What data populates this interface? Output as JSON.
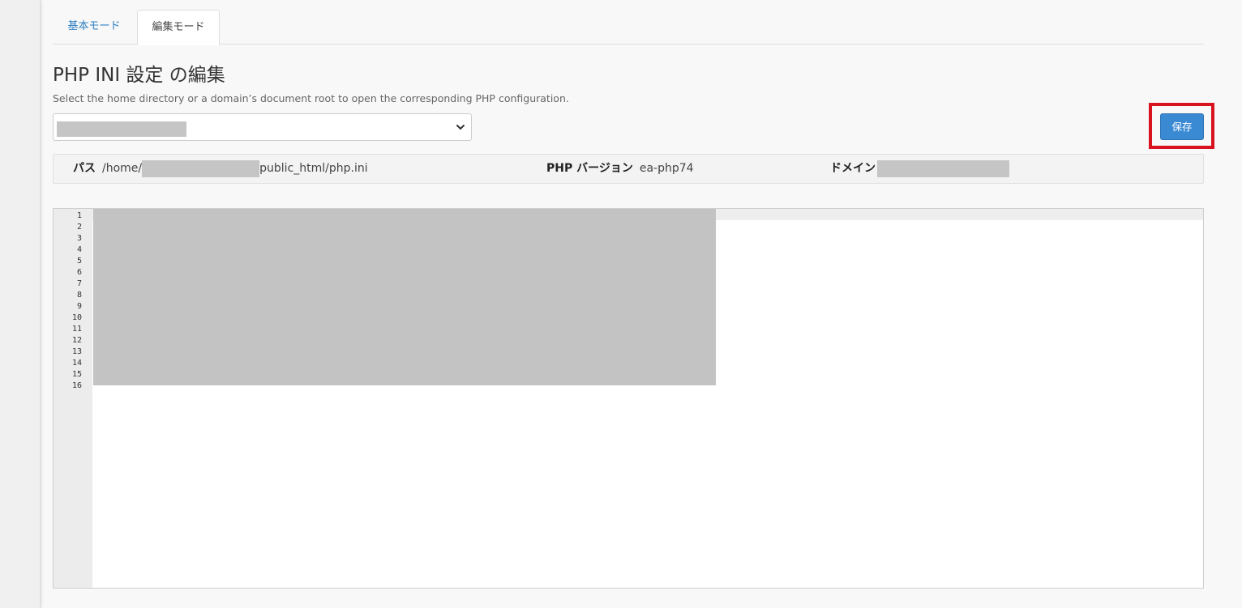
{
  "tabs": [
    {
      "label": "基本モード",
      "active": false
    },
    {
      "label": "編集モード",
      "active": true
    }
  ],
  "page": {
    "title": "PHP INI 設定 の編集",
    "subtitle": "Select the home directory or a domain’s document root to open the corresponding PHP configuration."
  },
  "directory_select": {
    "value_redacted": true
  },
  "toolbar": {
    "save_label": "保存"
  },
  "info": {
    "path_label": "パス",
    "path_prefix": "/home/",
    "path_suffix": "public_html/php.ini",
    "php_version_label": "PHP バージョン",
    "php_version_value": "ea-php74",
    "domain_label": "ドメイン"
  },
  "editor": {
    "line_numbers": [
      "1",
      "2",
      "3",
      "4",
      "5",
      "6",
      "7",
      "8",
      "9",
      "10",
      "11",
      "12",
      "13",
      "14",
      "15",
      "16"
    ],
    "content_redacted": true
  },
  "colors": {
    "tab_link": "#2e7fc2",
    "save_button": "#3a8ad3",
    "highlight_box": "#d9121f",
    "redaction": "#c5c5c5"
  },
  "icons": {
    "select_caret": "chevron-down-icon"
  }
}
